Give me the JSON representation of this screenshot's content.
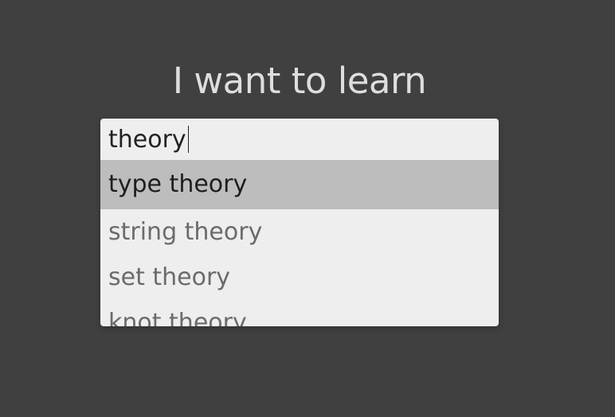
{
  "header": {
    "title": "I want to learn"
  },
  "search": {
    "value": "theory"
  },
  "suggestions": [
    {
      "label": "type theory",
      "active": true
    },
    {
      "label": "string theory",
      "active": false
    },
    {
      "label": "set theory",
      "active": false
    },
    {
      "label": "knot theory",
      "active": false
    }
  ],
  "colors": {
    "background": "#404040",
    "box": "#eeeeee",
    "highlight": "#bdbdbd",
    "title": "#dedede"
  }
}
